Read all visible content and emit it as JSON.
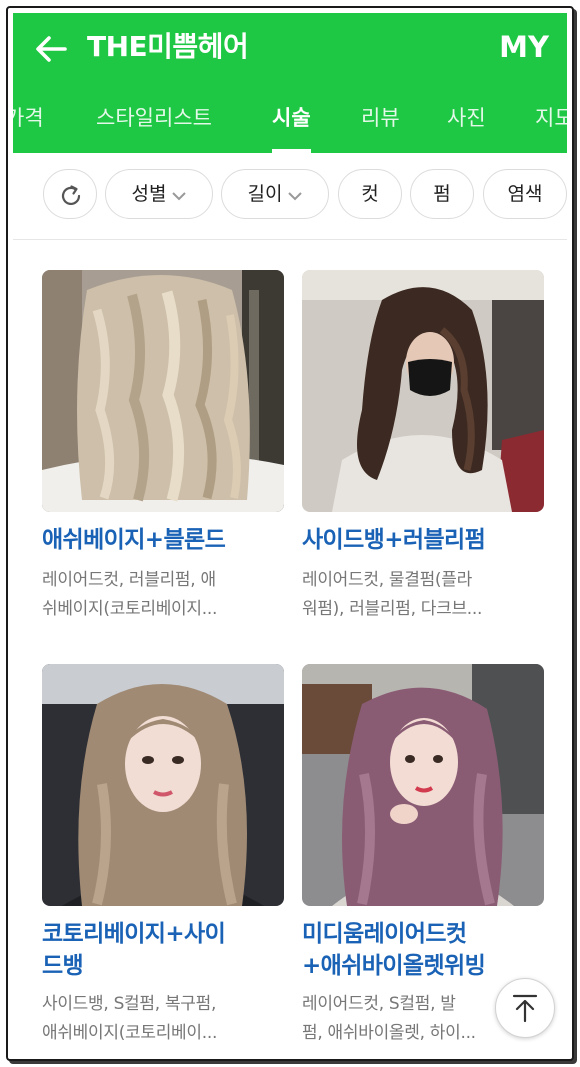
{
  "header": {
    "title": "THE미쁨헤어",
    "my_label": "MY",
    "colors": {
      "brand_green": "#1ec744",
      "title_blue": "#1a62b5"
    }
  },
  "tabs": [
    {
      "label": "가격",
      "active": false
    },
    {
      "label": "스타일리스트",
      "active": false
    },
    {
      "label": "시술",
      "active": true
    },
    {
      "label": "리뷰",
      "active": false
    },
    {
      "label": "사진",
      "active": false
    },
    {
      "label": "지도",
      "active": false
    }
  ],
  "filters": {
    "refresh_icon": "refresh-icon",
    "chips": [
      "성별",
      "길이",
      "컷",
      "펌",
      "염색"
    ]
  },
  "styles": [
    {
      "title": [
        "애쉬베이지+블론드"
      ],
      "desc": [
        "레이어드컷, 러블리펌, 애",
        "쉬베이지(코토리베이지..."
      ],
      "image": "photo: back view of long wavy ash-blonde hair"
    },
    {
      "title": [
        "사이드뱅+러블리펌"
      ],
      "desc": [
        "레이어드컷, 물결펌(플라",
        "워펌), 러블리펌, 다크브..."
      ],
      "image": "photo: woman in black mask with long dark brown waves"
    },
    {
      "title": [
        "코토리베이지+사이",
        "드뱅"
      ],
      "desc": [
        "사이드뱅, S컬펌, 복구펌,",
        "애쉬베이지(코토리베이..."
      ],
      "image": "photo: woman with long ash beige layered hair"
    },
    {
      "title": [
        "미디움레이어드컷",
        "+애쉬바이올렛위빙"
      ],
      "desc": [
        "레이어드컷, S컬펌, 발",
        "펌, 애쉬바이올렛, 하이..."
      ],
      "image": "photo: woman with long ash violet wavy hair"
    }
  ],
  "scroll_top_icon": "arrow-up-icon"
}
